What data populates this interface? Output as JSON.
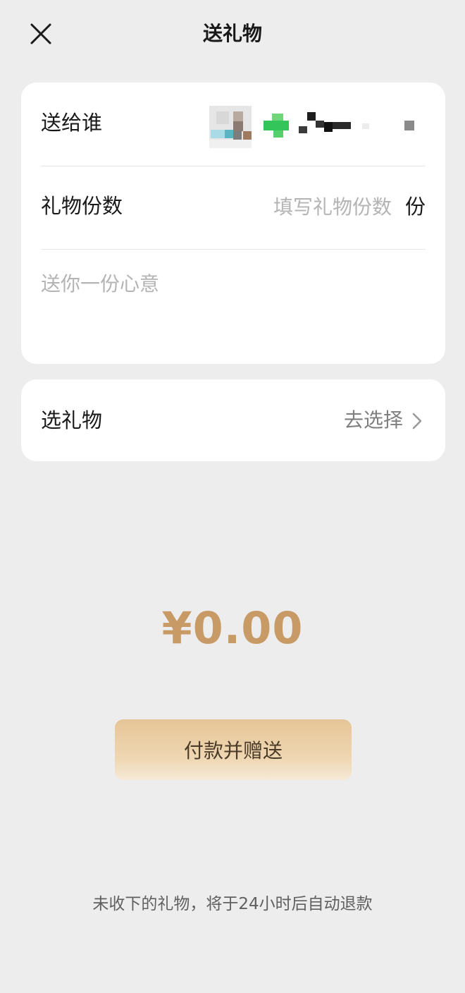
{
  "header": {
    "title": "送礼物",
    "close_icon": "close-icon"
  },
  "gift_form": {
    "recipient_label": "送给谁",
    "count_label": "礼物份数",
    "count_placeholder": "填写礼物份数",
    "count_value": "",
    "count_unit": "份",
    "message_placeholder": "送你一份心意",
    "message_value": ""
  },
  "select_gift": {
    "label": "选礼物",
    "action": "去选择",
    "chevron_icon": "chevron-right-icon"
  },
  "payment": {
    "amount": "¥0.00",
    "button_label": "付款并赠送"
  },
  "footer": {
    "note": "未收下的礼物，将于24小时后自动退款"
  },
  "colors": {
    "background": "#ededed",
    "amount": "#c89a65",
    "button": "#e5c596"
  }
}
